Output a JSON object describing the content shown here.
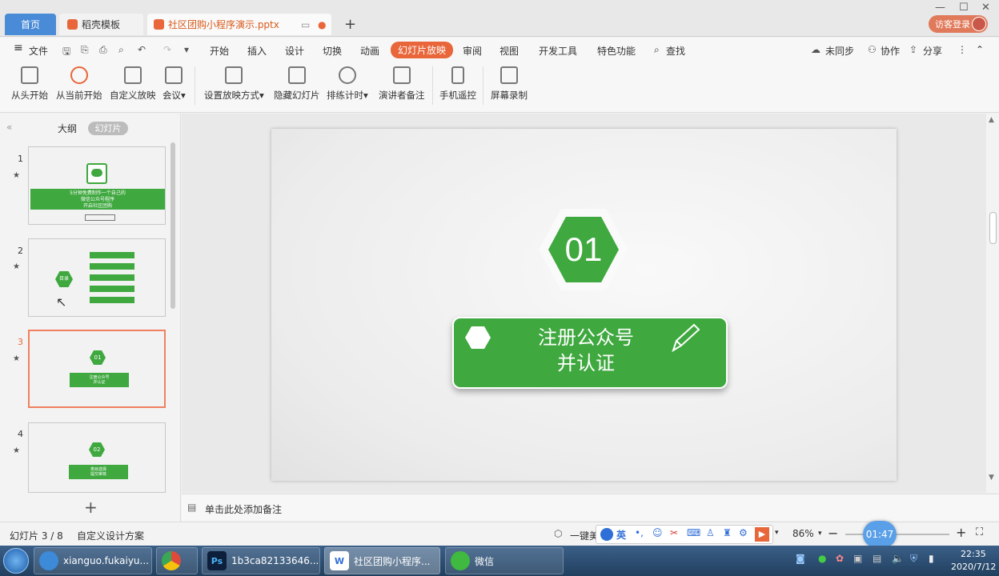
{
  "tabs": {
    "home": "首页",
    "template": "稻壳模板",
    "file": "社区团购小程序演示.pptx",
    "login": "访客登录"
  },
  "menu": {
    "file": "文件",
    "start": "开始",
    "insert": "插入",
    "design": "设计",
    "transition": "切换",
    "animation": "动画",
    "slideshow": "幻灯片放映",
    "review": "审阅",
    "view": "视图",
    "devtools": "开发工具",
    "special": "特色功能",
    "search": "查找",
    "sync": "未同步",
    "collab": "协作",
    "share": "分享"
  },
  "ribbon": [
    {
      "label": "从头开始"
    },
    {
      "label": "从当前开始"
    },
    {
      "label": "自定义放映"
    },
    {
      "label": "会议"
    },
    {
      "label": "设置放映方式"
    },
    {
      "label": "隐藏幻灯片"
    },
    {
      "label": "排练计时"
    },
    {
      "label": "演讲者备注"
    },
    {
      "label": "手机遥控"
    },
    {
      "label": "屏幕录制"
    }
  ],
  "panel": {
    "outline": "大纲",
    "slides": "幻灯片"
  },
  "thumbs": [
    {
      "num": "1",
      "line1": "5分钟免费制作一个自己的",
      "line2": "微信公众号程序",
      "line3": "开启社区团购"
    },
    {
      "num": "2",
      "center": "目录"
    },
    {
      "num": "3",
      "badge": "01",
      "t1": "注册公众号",
      "t2": "并认证"
    },
    {
      "num": "4",
      "badge": "02",
      "t1": "类目选择",
      "t2": "提交审核"
    }
  ],
  "slide": {
    "number": "01",
    "line1": "注册公众号",
    "line2": "并认证"
  },
  "notes": {
    "placeholder": "单击此处添加备注"
  },
  "status": {
    "slide_pos": "幻灯片 3 / 8",
    "theme": "自定义设计方案",
    "beautify": "一键美化",
    "zoom": "86%",
    "timer": "01:47"
  },
  "taskbar": {
    "items": [
      "xianguo.fukaiyu...",
      "",
      "1b3ca82133646...",
      "社区团购小程序...",
      "微信"
    ],
    "time": "22:35",
    "date": "2020/7/12",
    "ime": "英"
  },
  "colors": {
    "accent": "#e8663a",
    "green": "#3fa83f",
    "blue": "#4a8bd8"
  }
}
